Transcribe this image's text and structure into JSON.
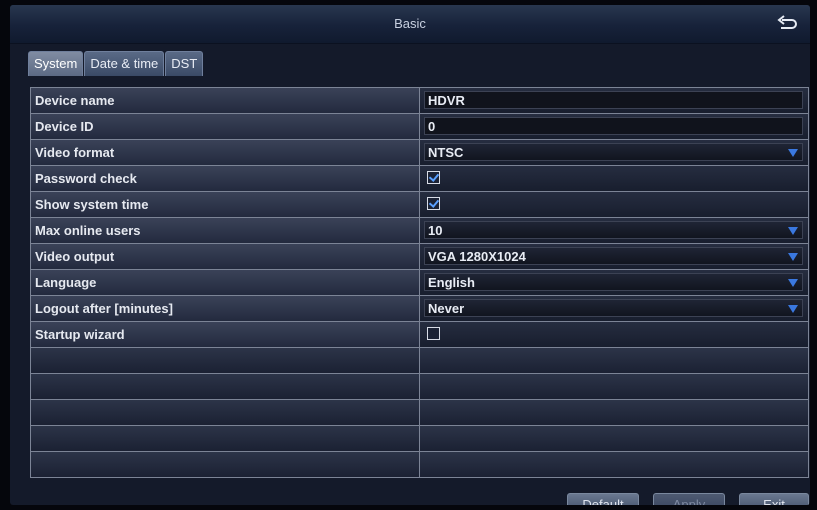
{
  "window": {
    "title": "Basic",
    "back_icon": "return-arrow-icon"
  },
  "tabs": [
    {
      "label": "System"
    },
    {
      "label": "Date & time"
    },
    {
      "label": "DST"
    }
  ],
  "settings": [
    {
      "label": "Device name",
      "type": "text",
      "value": "HDVR"
    },
    {
      "label": "Device ID",
      "type": "text",
      "value": "0"
    },
    {
      "label": "Video format",
      "type": "select",
      "value": "NTSC"
    },
    {
      "label": "Password check",
      "type": "checkbox",
      "checked": true
    },
    {
      "label": "Show system time",
      "type": "checkbox",
      "checked": true
    },
    {
      "label": "Max online users",
      "type": "select",
      "value": "10"
    },
    {
      "label": "Video output",
      "type": "select",
      "value": "VGA 1280X1024"
    },
    {
      "label": "Language",
      "type": "select",
      "value": "English"
    },
    {
      "label": "Logout after [minutes]",
      "type": "select",
      "value": "Never"
    },
    {
      "label": "Startup wizard",
      "type": "checkbox",
      "checked": false
    }
  ],
  "empty_rows": 5,
  "buttons": {
    "default": "Default",
    "apply": "Apply",
    "exit": "Exit"
  },
  "colors": {
    "dropdown_arrow": "#3a78e0",
    "checkmark": "#5aa0ff"
  }
}
